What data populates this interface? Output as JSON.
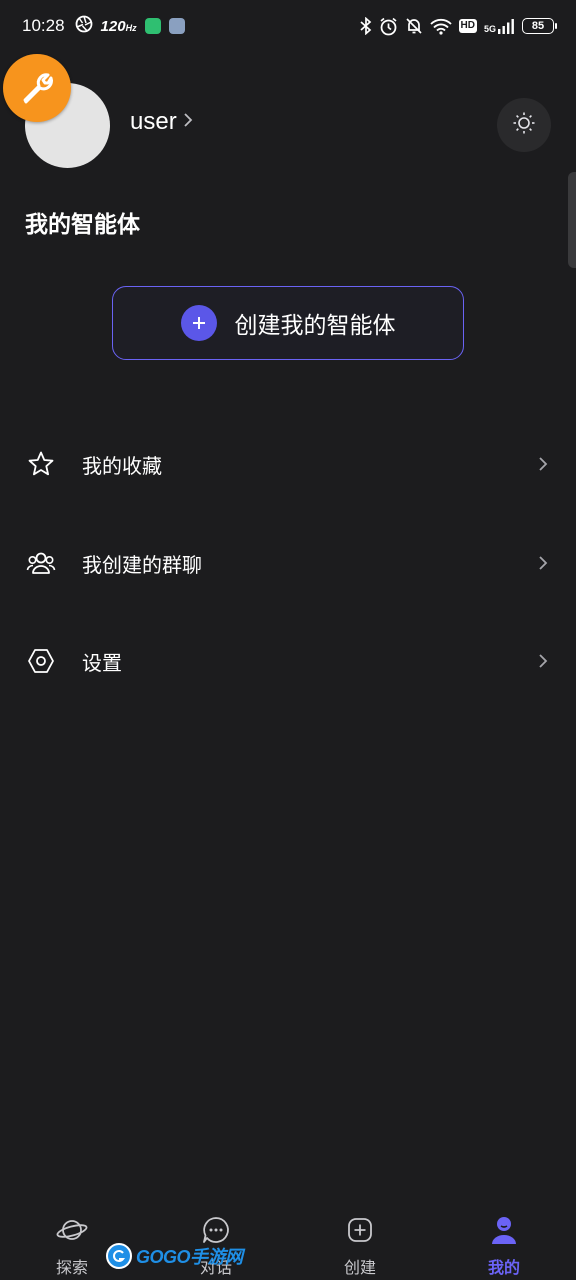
{
  "status_bar": {
    "time": "10:28",
    "refresh_rate": "120",
    "refresh_unit": "Hz",
    "hd_label": "HD",
    "network_label": "5G",
    "battery_level": "85"
  },
  "profile": {
    "username": "user",
    "avatar_color": "#e4e4e4",
    "badge_color": "#f7941d",
    "badge_icon": "wrench-icon",
    "theme_icon": "sun-icon"
  },
  "agents": {
    "section_title": "我的智能体",
    "create_button_label": "创建我的智能体",
    "accent_color": "#5b57e8"
  },
  "menu": {
    "items": [
      {
        "label": "我的收藏",
        "icon": "star-icon"
      },
      {
        "label": "我创建的群聊",
        "icon": "group-icon"
      },
      {
        "label": "设置",
        "icon": "settings-hexagon-icon"
      }
    ]
  },
  "bottom_nav": {
    "active_color": "#6b63f6",
    "tabs": [
      {
        "label": "探索",
        "icon": "planet-icon",
        "active": false
      },
      {
        "label": "对话",
        "icon": "chat-bubble-icon",
        "active": false
      },
      {
        "label": "创建",
        "icon": "plus-square-icon",
        "active": false
      },
      {
        "label": "我的",
        "icon": "person-icon",
        "active": true
      }
    ]
  },
  "watermark": {
    "text": "GOGO手游网"
  }
}
